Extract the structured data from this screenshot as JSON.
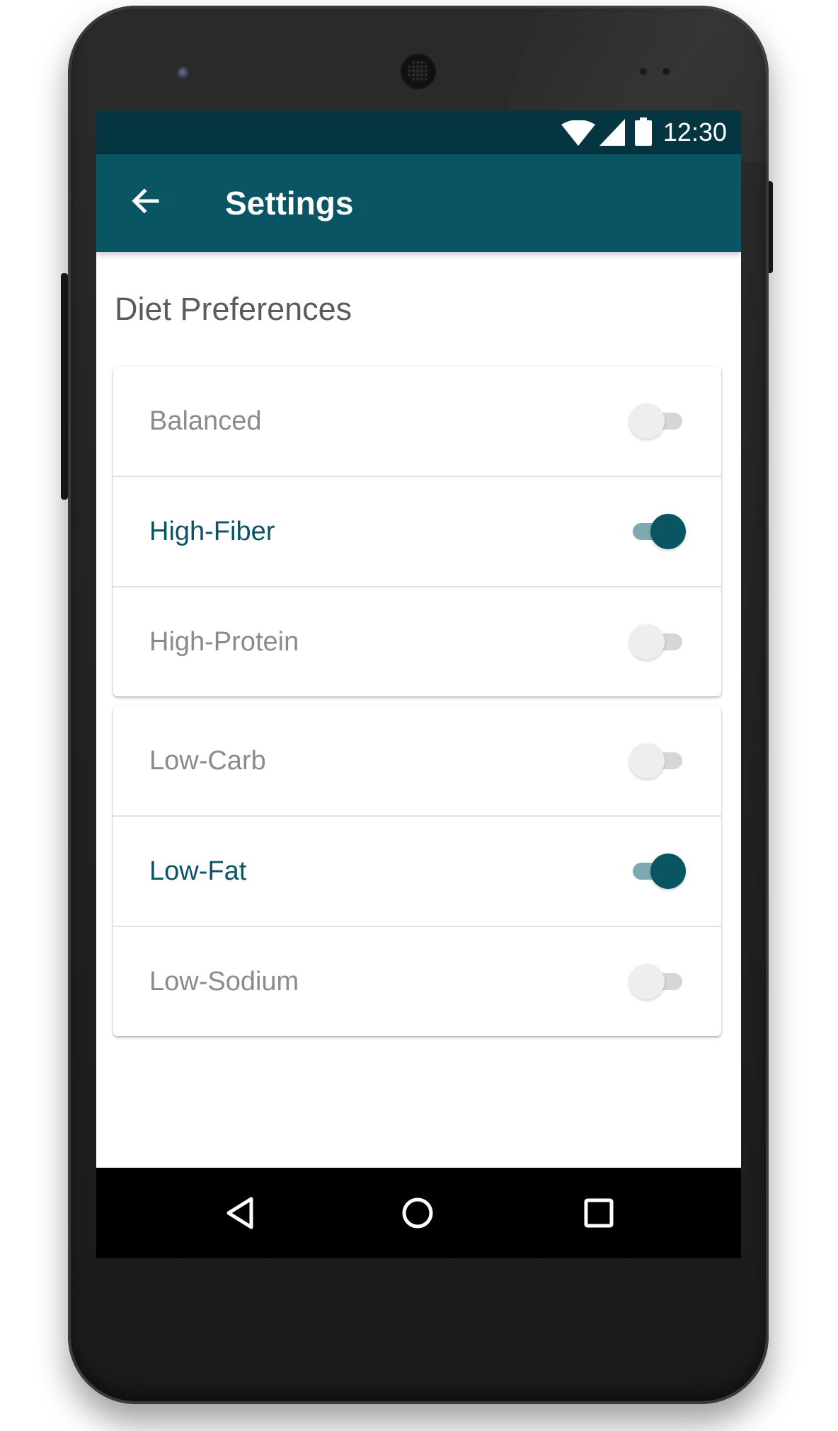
{
  "status_bar": {
    "time": "12:30",
    "icons": [
      "wifi-icon",
      "cellular-signal-icon",
      "battery-icon"
    ]
  },
  "app_bar": {
    "title": "Settings",
    "back_icon": "arrow-left-icon"
  },
  "section_title": "Diet Preferences",
  "groups": [
    {
      "items": [
        {
          "label": "Balanced",
          "enabled": false
        },
        {
          "label": "High-Fiber",
          "enabled": true
        },
        {
          "label": "High-Protein",
          "enabled": false
        }
      ]
    },
    {
      "items": [
        {
          "label": "Low-Carb",
          "enabled": false
        },
        {
          "label": "Low-Fat",
          "enabled": true
        },
        {
          "label": "Low-Sodium",
          "enabled": false
        }
      ]
    }
  ],
  "nav_bar": {
    "buttons": [
      "back-triangle-icon",
      "home-circle-icon",
      "recents-square-icon"
    ]
  },
  "colors": {
    "status_bar": "#043541",
    "app_bar": "#0a5563",
    "accent": "#0a5563",
    "switch_track_on": "#7fa9b1",
    "label_off": "#8b8b8b"
  }
}
